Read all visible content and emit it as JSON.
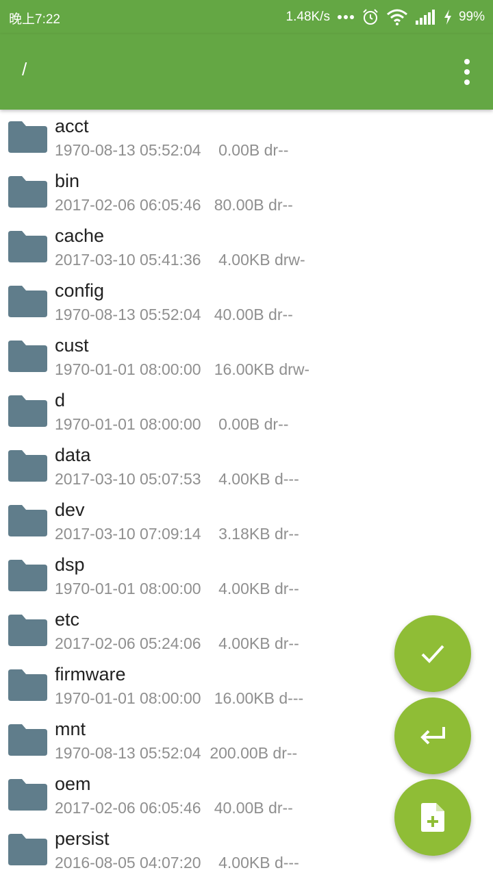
{
  "status_bar": {
    "time": "晚上7:22",
    "speed": "1.48K/s",
    "battery": "99%",
    "icons": [
      "more-dots-icon",
      "alarm-icon",
      "wifi-icon",
      "signal-icon",
      "charging-icon"
    ]
  },
  "toolbar": {
    "path": "/",
    "menu_icon": "overflow-menu-icon"
  },
  "colors": {
    "accent": "#64a744",
    "fab": "#8fbd36",
    "folder": "#607d8b",
    "primary_text": "#212121",
    "secondary_text": "#8f8f8f"
  },
  "files": [
    {
      "name": "acct",
      "meta": "1970-08-13 05:52:04    0.00B dr--"
    },
    {
      "name": "bin",
      "meta": "2017-02-06 06:05:46   80.00B dr--"
    },
    {
      "name": "cache",
      "meta": "2017-03-10 05:41:36    4.00KB drw-"
    },
    {
      "name": "config",
      "meta": "1970-08-13 05:52:04   40.00B dr--"
    },
    {
      "name": "cust",
      "meta": "1970-01-01 08:00:00   16.00KB drw-"
    },
    {
      "name": "d",
      "meta": "1970-01-01 08:00:00    0.00B dr--"
    },
    {
      "name": "data",
      "meta": "2017-03-10 05:07:53    4.00KB d---"
    },
    {
      "name": "dev",
      "meta": "2017-03-10 07:09:14    3.18KB dr--"
    },
    {
      "name": "dsp",
      "meta": "1970-01-01 08:00:00    4.00KB dr--"
    },
    {
      "name": "etc",
      "meta": "2017-02-06 05:24:06    4.00KB dr--"
    },
    {
      "name": "firmware",
      "meta": "1970-01-01 08:00:00   16.00KB d---"
    },
    {
      "name": "mnt",
      "meta": "1970-08-13 05:52:04  200.00B dr--"
    },
    {
      "name": "oem",
      "meta": "2017-02-06 06:05:46   40.00B dr--"
    },
    {
      "name": "persist",
      "meta": "2016-08-05 04:07:20    4.00KB d---"
    }
  ],
  "fabs": [
    "check-icon",
    "return-icon",
    "new-file-icon"
  ]
}
